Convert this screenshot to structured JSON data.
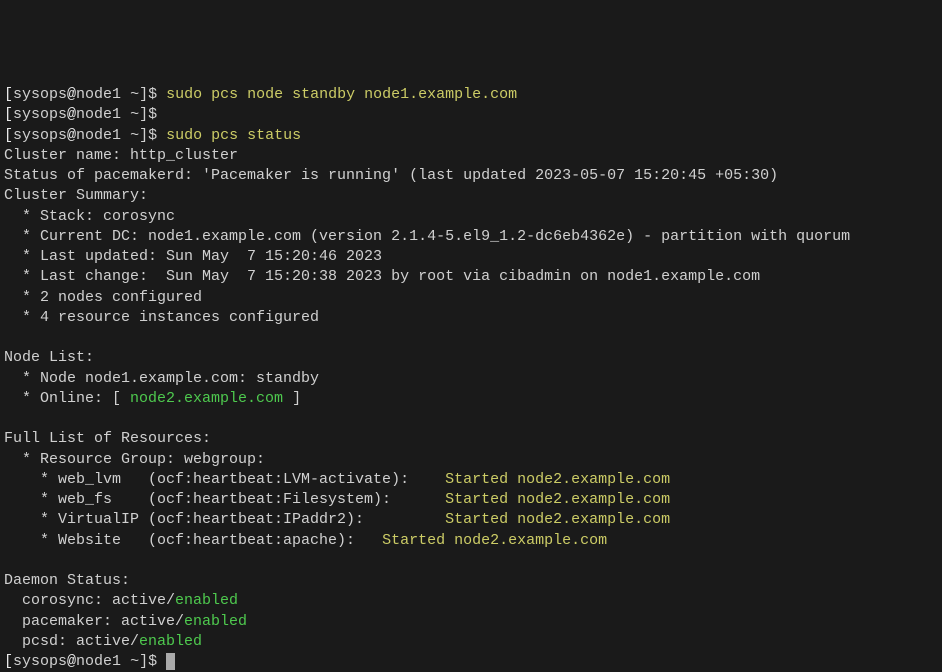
{
  "p1": {
    "user": "sysops",
    "host": "node1",
    "path": "~",
    "sym": "]$",
    "cmd": "sudo pcs node standby node1.example.com"
  },
  "p2": {
    "user": "sysops",
    "host": "node1",
    "path": "~",
    "sym": "]$"
  },
  "p3": {
    "user": "sysops",
    "host": "node1",
    "path": "~",
    "sym": "]$",
    "cmd": "sudo pcs status"
  },
  "cluster_name_lbl": "Cluster name: ",
  "cluster_name": "http_cluster",
  "status_pm": "Status of pacemakerd: 'Pacemaker is running' (last updated 2023-05-07 15:20:45 +05:30)",
  "cs_hdr": "Cluster Summary:",
  "cs_stack": "  * Stack: corosync",
  "cs_dc": "  * Current DC: node1.example.com (version 2.1.4-5.el9_1.2-dc6eb4362e) - partition with quorum",
  "cs_lu": "  * Last updated: Sun May  7 15:20:46 2023",
  "cs_lc": "  * Last change:  Sun May  7 15:20:38 2023 by root via cibadmin on node1.example.com",
  "cs_nodes": "  * 2 nodes configured",
  "cs_res": "  * 4 resource instances configured",
  "nl_hdr": "Node List:",
  "nl_standby": "  * Node node1.example.com: standby",
  "nl_online_pre": "  * Online: [ ",
  "nl_online_node": "node2.example.com",
  "nl_online_post": " ]",
  "fr_hdr": "Full List of Resources:",
  "fr_group": "  * Resource Group: webgroup:",
  "r1": {
    "pre": "    * web_lvm   (ocf:heartbeat:LVM-activate):    ",
    "status": "Started node2.example.com"
  },
  "r2": {
    "pre": "    * web_fs    (ocf:heartbeat:Filesystem):      ",
    "status": "Started node2.example.com"
  },
  "r3": {
    "pre": "    * VirtualIP (ocf:heartbeat:IPaddr2):         ",
    "status": "Started node2.example.com"
  },
  "r4": {
    "pre": "    * Website   (ocf:heartbeat:apache):   ",
    "status": "Started node2.example.com"
  },
  "ds_hdr": "Daemon Status:",
  "d1": {
    "pre": "  corosync: active/",
    "status": "enabled"
  },
  "d2": {
    "pre": "  pacemaker: active/",
    "status": "enabled"
  },
  "d3": {
    "pre": "  pcsd: active/",
    "status": "enabled"
  },
  "p4": {
    "user": "sysops",
    "host": "node1",
    "path": "~",
    "sym": "]$"
  }
}
